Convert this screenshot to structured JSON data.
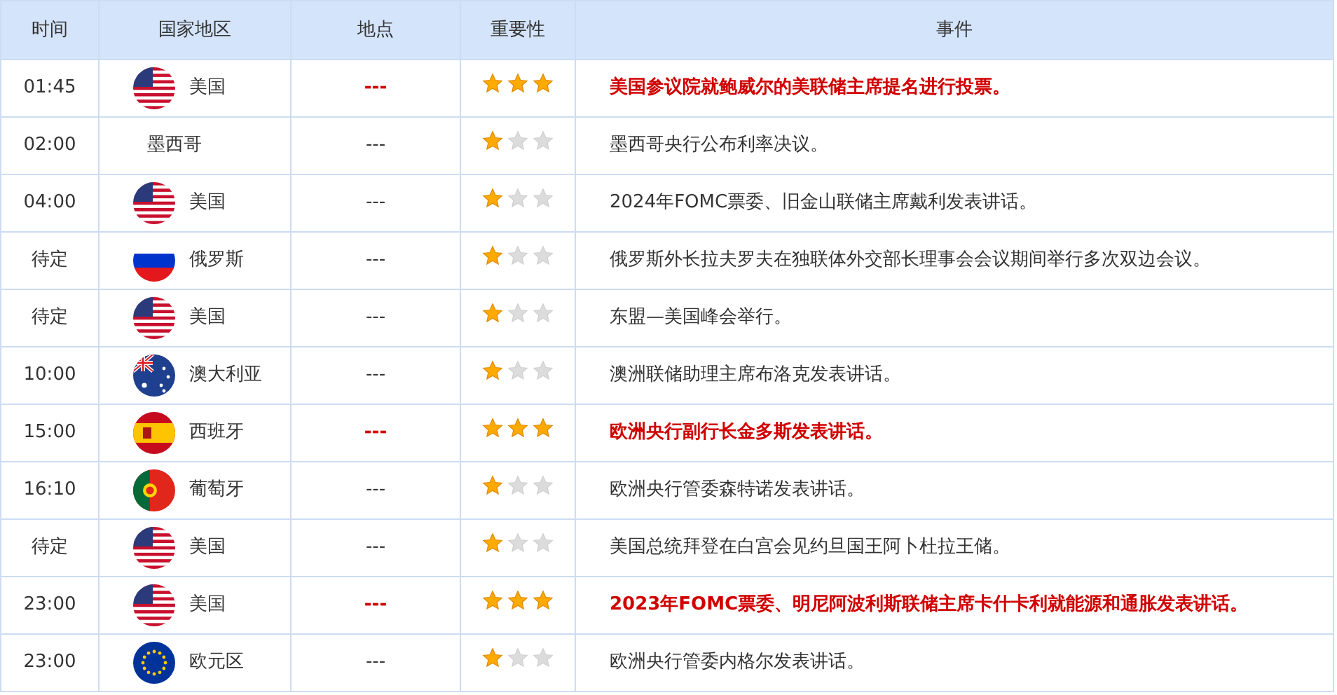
{
  "table": {
    "columns": [
      "时间",
      "国家地区",
      "地点",
      "重要性",
      "事件"
    ],
    "rows": [
      {
        "time": "01:45",
        "kind": "us",
        "country": "美国",
        "place": "---",
        "stars": 3,
        "important": true,
        "event": "美国参议院就鲍威尔的美联储主席提名进行投票。"
      },
      {
        "time": "02:00",
        "kind": "plain",
        "country": "墨西哥",
        "place": "---",
        "stars": 1,
        "important": false,
        "event": "墨西哥央行公布利率决议。"
      },
      {
        "time": "04:00",
        "kind": "us",
        "country": "美国",
        "place": "---",
        "stars": 1,
        "important": false,
        "event": "2024年FOMC票委、旧金山联储主席戴利发表讲话。"
      },
      {
        "time": "待定",
        "kind": "ru",
        "country": "俄罗斯",
        "place": "---",
        "stars": 1,
        "important": false,
        "event": "俄罗斯外长拉夫罗夫在独联体外交部长理事会会议期间举行多次双边会议。"
      },
      {
        "time": "待定",
        "kind": "us",
        "country": "美国",
        "place": "---",
        "stars": 1,
        "important": false,
        "event": "东盟—美国峰会举行。"
      },
      {
        "time": "10:00",
        "kind": "au",
        "country": "澳大利亚",
        "place": "---",
        "stars": 1,
        "important": false,
        "event": "澳洲联储助理主席布洛克发表讲话。"
      },
      {
        "time": "15:00",
        "kind": "es",
        "country": "西班牙",
        "place": "---",
        "stars": 3,
        "important": true,
        "event": "欧洲央行副行长金多斯发表讲话。"
      },
      {
        "time": "16:10",
        "kind": "pt",
        "country": "葡萄牙",
        "place": "---",
        "stars": 1,
        "important": false,
        "event": "欧洲央行管委森特诺发表讲话。"
      },
      {
        "time": "待定",
        "kind": "us",
        "country": "美国",
        "place": "---",
        "stars": 1,
        "important": false,
        "event": "美国总统拜登在白宫会见约旦国王阿卜杜拉王储。"
      },
      {
        "time": "23:00",
        "kind": "us",
        "country": "美国",
        "place": "---",
        "stars": 3,
        "important": true,
        "event": "2023年FOMC票委、明尼阿波利斯联储主席卡什卡利就能源和通胀发表讲话。"
      },
      {
        "time": "23:00",
        "kind": "eu",
        "country": "欧元区",
        "place": "---",
        "stars": 1,
        "important": false,
        "event": "欧洲央行管委内格尔发表讲话。"
      }
    ]
  }
}
